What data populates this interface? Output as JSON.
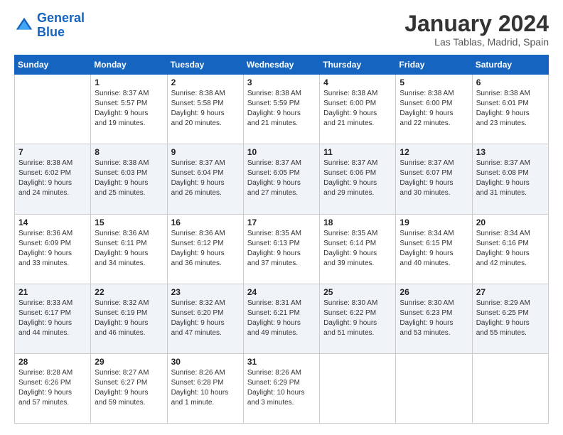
{
  "logo": {
    "line1": "General",
    "line2": "Blue"
  },
  "title": "January 2024",
  "subtitle": "Las Tablas, Madrid, Spain",
  "weekdays": [
    "Sunday",
    "Monday",
    "Tuesday",
    "Wednesday",
    "Thursday",
    "Friday",
    "Saturday"
  ],
  "weeks": [
    [
      {
        "day": "",
        "info": ""
      },
      {
        "day": "1",
        "info": "Sunrise: 8:37 AM\nSunset: 5:57 PM\nDaylight: 9 hours\nand 19 minutes."
      },
      {
        "day": "2",
        "info": "Sunrise: 8:38 AM\nSunset: 5:58 PM\nDaylight: 9 hours\nand 20 minutes."
      },
      {
        "day": "3",
        "info": "Sunrise: 8:38 AM\nSunset: 5:59 PM\nDaylight: 9 hours\nand 21 minutes."
      },
      {
        "day": "4",
        "info": "Sunrise: 8:38 AM\nSunset: 6:00 PM\nDaylight: 9 hours\nand 21 minutes."
      },
      {
        "day": "5",
        "info": "Sunrise: 8:38 AM\nSunset: 6:00 PM\nDaylight: 9 hours\nand 22 minutes."
      },
      {
        "day": "6",
        "info": "Sunrise: 8:38 AM\nSunset: 6:01 PM\nDaylight: 9 hours\nand 23 minutes."
      }
    ],
    [
      {
        "day": "7",
        "info": "Sunrise: 8:38 AM\nSunset: 6:02 PM\nDaylight: 9 hours\nand 24 minutes."
      },
      {
        "day": "8",
        "info": "Sunrise: 8:38 AM\nSunset: 6:03 PM\nDaylight: 9 hours\nand 25 minutes."
      },
      {
        "day": "9",
        "info": "Sunrise: 8:37 AM\nSunset: 6:04 PM\nDaylight: 9 hours\nand 26 minutes."
      },
      {
        "day": "10",
        "info": "Sunrise: 8:37 AM\nSunset: 6:05 PM\nDaylight: 9 hours\nand 27 minutes."
      },
      {
        "day": "11",
        "info": "Sunrise: 8:37 AM\nSunset: 6:06 PM\nDaylight: 9 hours\nand 29 minutes."
      },
      {
        "day": "12",
        "info": "Sunrise: 8:37 AM\nSunset: 6:07 PM\nDaylight: 9 hours\nand 30 minutes."
      },
      {
        "day": "13",
        "info": "Sunrise: 8:37 AM\nSunset: 6:08 PM\nDaylight: 9 hours\nand 31 minutes."
      }
    ],
    [
      {
        "day": "14",
        "info": "Sunrise: 8:36 AM\nSunset: 6:09 PM\nDaylight: 9 hours\nand 33 minutes."
      },
      {
        "day": "15",
        "info": "Sunrise: 8:36 AM\nSunset: 6:11 PM\nDaylight: 9 hours\nand 34 minutes."
      },
      {
        "day": "16",
        "info": "Sunrise: 8:36 AM\nSunset: 6:12 PM\nDaylight: 9 hours\nand 36 minutes."
      },
      {
        "day": "17",
        "info": "Sunrise: 8:35 AM\nSunset: 6:13 PM\nDaylight: 9 hours\nand 37 minutes."
      },
      {
        "day": "18",
        "info": "Sunrise: 8:35 AM\nSunset: 6:14 PM\nDaylight: 9 hours\nand 39 minutes."
      },
      {
        "day": "19",
        "info": "Sunrise: 8:34 AM\nSunset: 6:15 PM\nDaylight: 9 hours\nand 40 minutes."
      },
      {
        "day": "20",
        "info": "Sunrise: 8:34 AM\nSunset: 6:16 PM\nDaylight: 9 hours\nand 42 minutes."
      }
    ],
    [
      {
        "day": "21",
        "info": "Sunrise: 8:33 AM\nSunset: 6:17 PM\nDaylight: 9 hours\nand 44 minutes."
      },
      {
        "day": "22",
        "info": "Sunrise: 8:32 AM\nSunset: 6:19 PM\nDaylight: 9 hours\nand 46 minutes."
      },
      {
        "day": "23",
        "info": "Sunrise: 8:32 AM\nSunset: 6:20 PM\nDaylight: 9 hours\nand 47 minutes."
      },
      {
        "day": "24",
        "info": "Sunrise: 8:31 AM\nSunset: 6:21 PM\nDaylight: 9 hours\nand 49 minutes."
      },
      {
        "day": "25",
        "info": "Sunrise: 8:30 AM\nSunset: 6:22 PM\nDaylight: 9 hours\nand 51 minutes."
      },
      {
        "day": "26",
        "info": "Sunrise: 8:30 AM\nSunset: 6:23 PM\nDaylight: 9 hours\nand 53 minutes."
      },
      {
        "day": "27",
        "info": "Sunrise: 8:29 AM\nSunset: 6:25 PM\nDaylight: 9 hours\nand 55 minutes."
      }
    ],
    [
      {
        "day": "28",
        "info": "Sunrise: 8:28 AM\nSunset: 6:26 PM\nDaylight: 9 hours\nand 57 minutes."
      },
      {
        "day": "29",
        "info": "Sunrise: 8:27 AM\nSunset: 6:27 PM\nDaylight: 9 hours\nand 59 minutes."
      },
      {
        "day": "30",
        "info": "Sunrise: 8:26 AM\nSunset: 6:28 PM\nDaylight: 10 hours\nand 1 minute."
      },
      {
        "day": "31",
        "info": "Sunrise: 8:26 AM\nSunset: 6:29 PM\nDaylight: 10 hours\nand 3 minutes."
      },
      {
        "day": "",
        "info": ""
      },
      {
        "day": "",
        "info": ""
      },
      {
        "day": "",
        "info": ""
      }
    ]
  ]
}
